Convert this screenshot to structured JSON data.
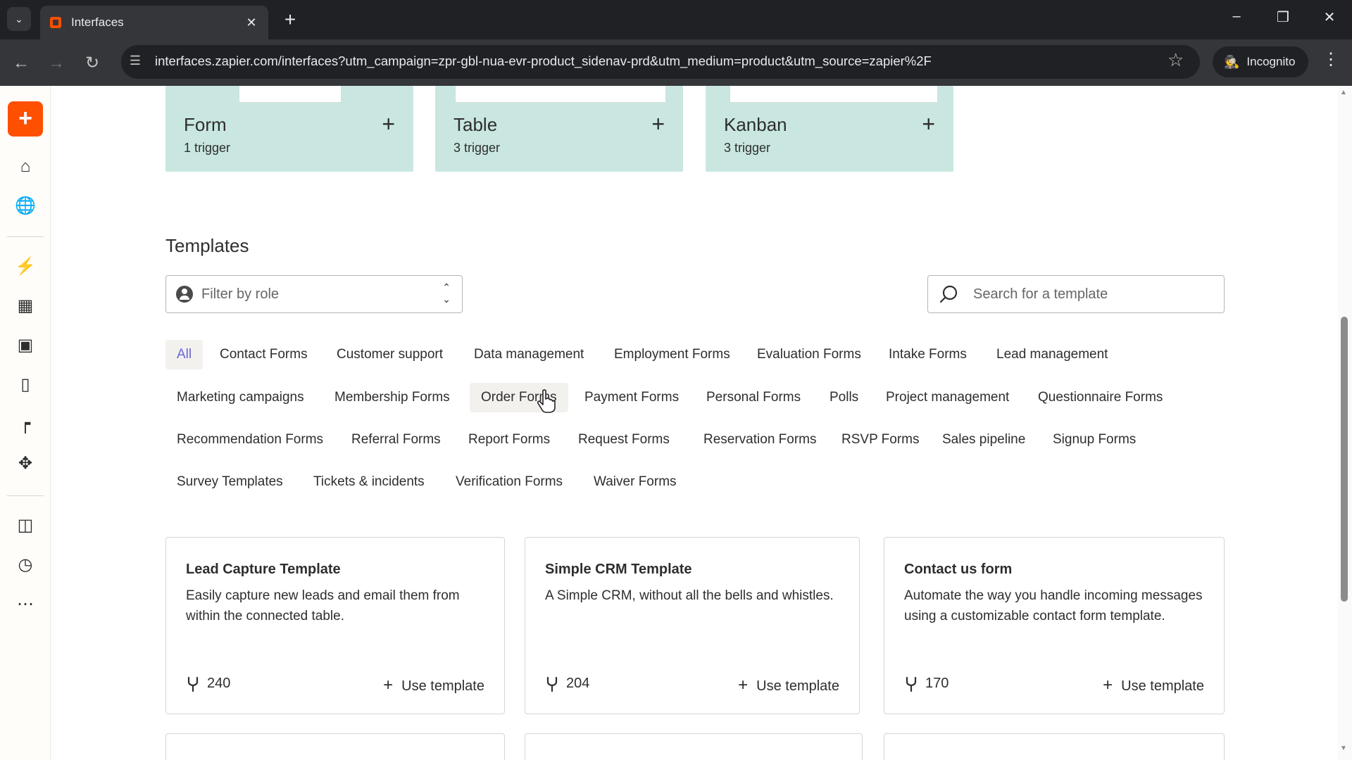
{
  "browser": {
    "tab_title": "Interfaces",
    "url": "interfaces.zapier.com/interfaces?utm_campaign=zpr-gbl-nua-evr-product_sidenav-prd&utm_medium=product&utm_source=zapier%2F",
    "incognito_label": "Incognito"
  },
  "start_cards": [
    {
      "title": "Form",
      "subtitle": "1 trigger"
    },
    {
      "title": "Table",
      "subtitle": "3 trigger"
    },
    {
      "title": "Kanban",
      "subtitle": "3 trigger"
    }
  ],
  "templates": {
    "title": "Templates",
    "filter_placeholder": "Filter by role",
    "search_placeholder": "Search for a template",
    "categories": [
      "All",
      "Contact Forms",
      "Customer support",
      "Data management",
      "Employment Forms",
      "Evaluation Forms",
      "Intake Forms",
      "Lead management",
      "Marketing campaigns",
      "Membership Forms",
      "Order Forms",
      "Payment Forms",
      "Personal Forms",
      "Polls",
      "Project management",
      "Questionnaire Forms",
      "Recommendation Forms",
      "Referral Forms",
      "Report Forms",
      "Request Forms",
      "Reservation Forms",
      "RSVP Forms",
      "Sales pipeline",
      "Signup Forms",
      "Survey Templates",
      "Tickets & incidents",
      "Verification Forms",
      "Waiver Forms"
    ],
    "active_category": "All",
    "cards": [
      {
        "title": "Lead Capture Template",
        "description": "Easily capture new leads and email them from within the connected table.",
        "uses": "240",
        "action": "Use template"
      },
      {
        "title": "Simple CRM Template",
        "description": "A Simple CRM, without all the bells and whistles.",
        "uses": "204",
        "action": "Use template"
      },
      {
        "title": "Contact us form",
        "description": "Automate the way you handle incoming messages using a customizable contact form template.",
        "uses": "170",
        "action": "Use template"
      }
    ]
  },
  "colors": {
    "brand_orange": "#ff4f00",
    "card_teal": "#c9e7e0",
    "active_chip_text": "#6a66d9"
  },
  "icons": {
    "sidebar": [
      "home-icon",
      "globe-icon",
      "zap-icon",
      "tables-icon",
      "interfaces-icon",
      "chatbots-icon",
      "canvas-icon",
      "agents-icon",
      "apps-icon",
      "history-icon",
      "more-icon"
    ]
  }
}
